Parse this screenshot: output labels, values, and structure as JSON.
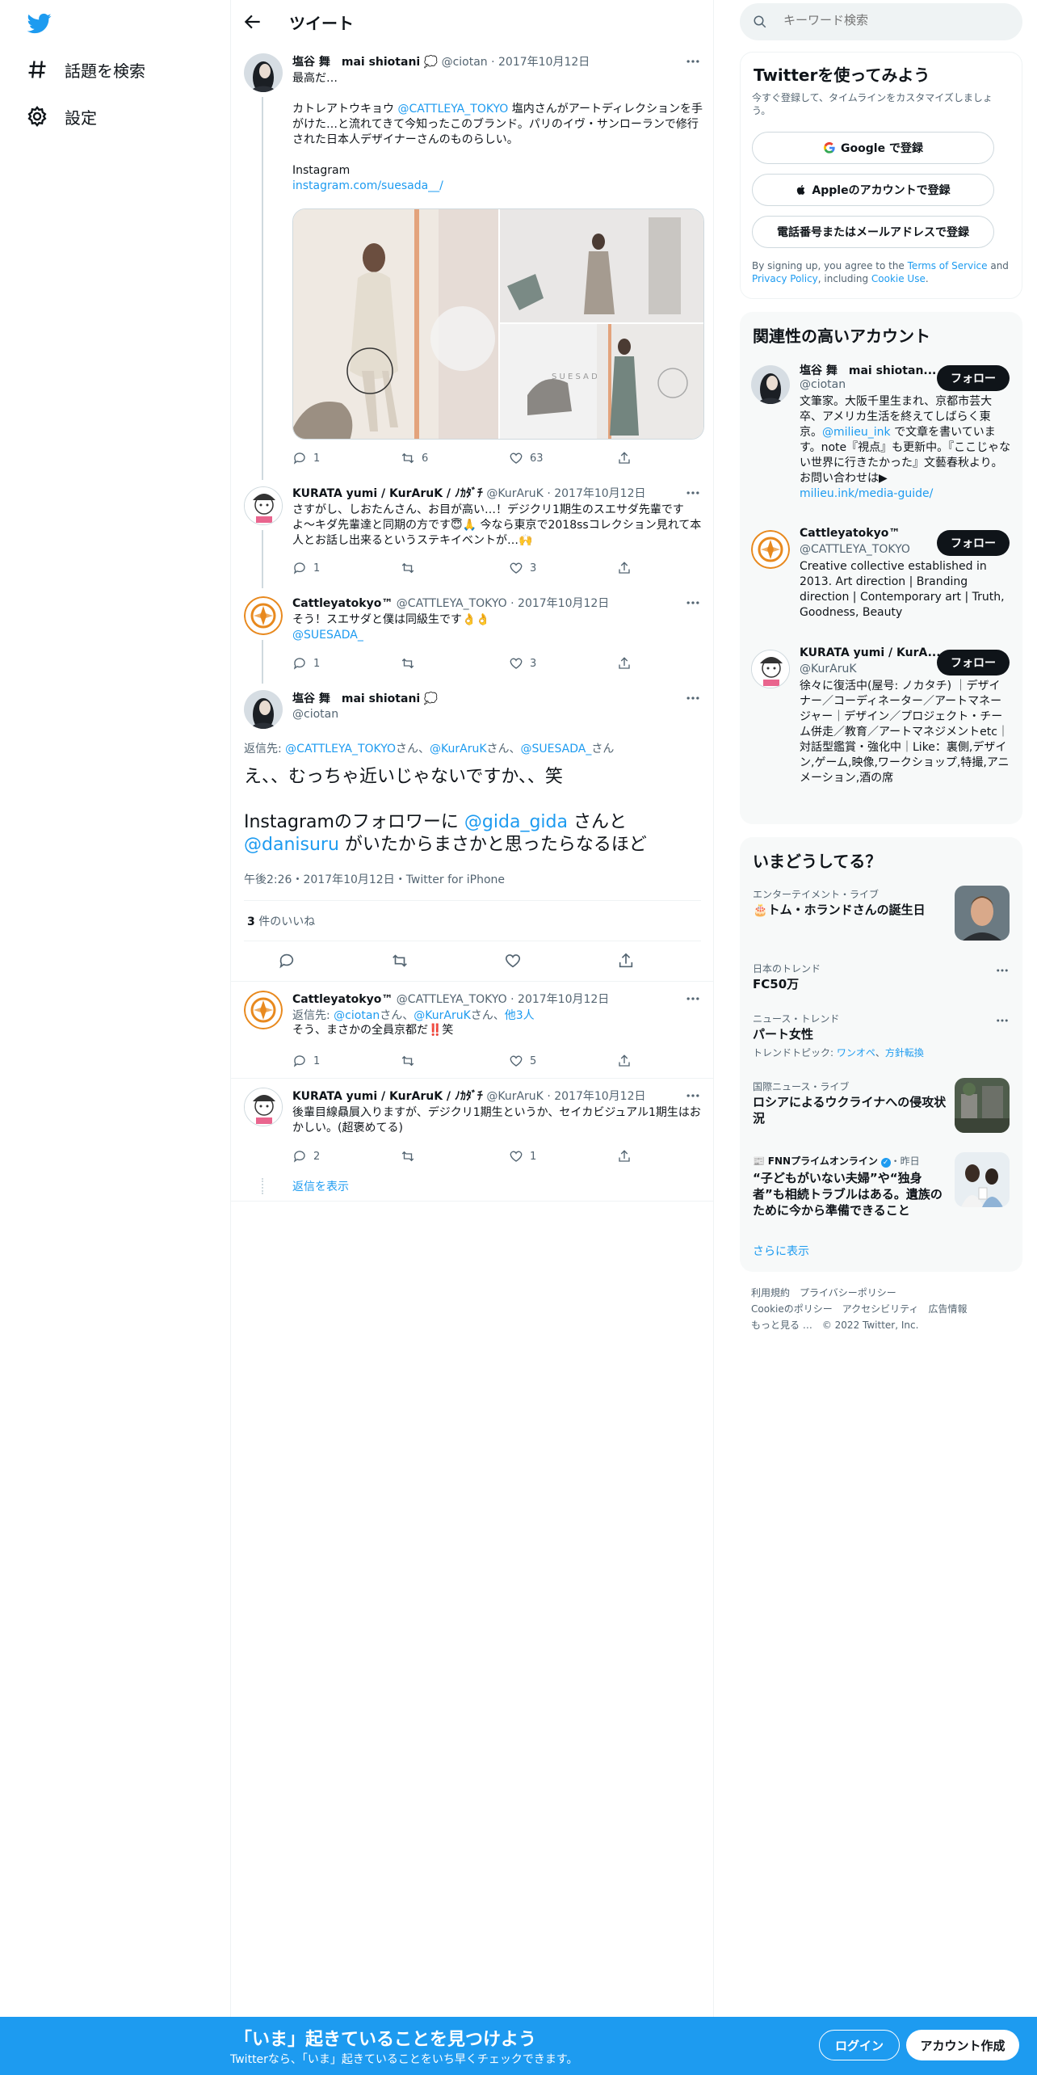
{
  "nav": {
    "explore_label": "話題を検索",
    "settings_label": "設定"
  },
  "header": {
    "title": "ツイート"
  },
  "tweets": [
    {
      "name": "塩谷 舞　mai shiotani",
      "handle": "@ciotan",
      "date": "2017年10月12日",
      "text_intro": "最高だ…",
      "text_body_pre": "カトレアトウキョウ ",
      "text_mention": "@CATTLEYA_TOKYO",
      "text_body_post": " 塩内さんがアートディレクションを手がけた…と流れてきて今知ったこのブランド。パリのイヴ・サンローランで修行された日本人デザイナーさんのものらしい。",
      "text_instagram": "Instagram",
      "text_link": "instagram.com/suesada__/",
      "replies": "1",
      "retweets": "6",
      "likes": "63"
    },
    {
      "name": "KURATA yumi / KurAruK / ﾉｶﾀﾞﾁ",
      "handle": "@KurAruK",
      "date": "2017年10月12日",
      "text": "さすがし、しおたんさん、お目が高い…！デジクリ1期生のスエサダ先輩ですよ〜キダ先輩達と同期の方です😇🙏 今なら東京で2018ssコレクション見れて本人とお話し出来るというステキイベントが…🙌",
      "replies": "1",
      "retweets": "",
      "likes": "3"
    },
    {
      "name": "Cattleyatokyo™",
      "handle": "@CATTLEYA_TOKYO",
      "date": "2017年10月12日",
      "text": "そう！スエサダと僕は同級生です👌👌",
      "mention": "@SUESADA_",
      "replies": "1",
      "retweets": "",
      "likes": "3"
    }
  ],
  "focus": {
    "name": "塩谷 舞　mai shiotani",
    "handle": "@ciotan",
    "reply_to_label": "返信先:",
    "reply_to_1": "@CATTLEYA_TOKYO",
    "reply_to_san1": "さん、",
    "reply_to_2": "@KurAruK",
    "reply_to_san2": "さん、",
    "reply_to_3": "@SUESADA_",
    "reply_to_san3": "さん",
    "line1": "え、、むっちゃ近いじゃないですか、、笑",
    "line2_pre": "Instagramのフォロワーに ",
    "line2_m1": "@gida_gida",
    "line2_mid": " さんと",
    "line3_m2": "@danisuru",
    "line3_post": " がいたからまさかと思ったらなるほど",
    "meta": "午後2:26・2017年10月12日・Twitter for iPhone",
    "likes_count": "3",
    "likes_label": " 件のいいね"
  },
  "replies": [
    {
      "name": "Cattleyatokyo™",
      "handle": "@CATTLEYA_TOKYO",
      "date": "2017年10月12日",
      "reply_label": "返信先: ",
      "reply_1": "@ciotan",
      "reply_san1": "さん、",
      "reply_2": "@KurAruK",
      "reply_san2": "さん、",
      "reply_more": "他3人",
      "text": "そう、まさかの全員京都だ‼️笑",
      "replies": "1",
      "retweets": "",
      "likes": "5"
    },
    {
      "name": "KURATA yumi / KurAruK / ﾉｶﾀﾞﾁ",
      "handle": "@KurAruK",
      "date": "2017年10月12日",
      "text": "後輩目線贔屓入りますが、デジクリ1期生というか、セイカビジュアル1期生はおかしい。(超褒めてる)",
      "replies": "2",
      "retweets": "",
      "likes": "1"
    }
  ],
  "show_replies": "返信を表示",
  "search": {
    "placeholder": "キーワード検索"
  },
  "signup_card": {
    "title": "Twitterを使ってみよう",
    "subtitle": "今すぐ登録して、タイムラインをカスタマイズしましょう。",
    "google": "Google で登録",
    "apple": "Appleのアカウントで登録",
    "phone": "電話番号またはメールアドレスで登録",
    "terms_pre": "By signing up, you agree to the ",
    "terms_link": "Terms of Service",
    "terms_and": " and ",
    "privacy_link": "Privacy Policy",
    "terms_including": ", including ",
    "cookie_link": "Cookie Use",
    "terms_end": "."
  },
  "accounts_card": {
    "title": "関連性の高いアカウント",
    "follow_label": "フォロー",
    "accounts": [
      {
        "name": "塩谷 舞　mai shiotan...",
        "handle": "@ciotan",
        "bio_pre": "文筆家。大阪千里生まれ、京都市芸大卒、アメリカ生活を終えてしばらく東京。",
        "bio_mention": "@milieu_ink",
        "bio_post": " で文章を書いています。note『視点』も更新中。『ここじゃない世界に行きたかった』文藝春秋より。お問い合わせは▶",
        "bio_link": "milieu.ink/media-guide/"
      },
      {
        "name": "Cattleyatokyo™",
        "handle": "@CATTLEYA_TOKYO",
        "bio": "Creative collective established in 2013. Art direction | Branding direction | Contemporary art | Truth, Goodness, Beauty"
      },
      {
        "name": "KURATA yumi / KurA...",
        "handle": "@KurAruK",
        "bio": "徐々に復活中(屋号: ノカタチ) ｜デザイナー／コーディネーター／アートマネージャー｜デザイン／プロジェクト・チーム併走／教育／アートマネジメントetc｜対話型鑑賞・強化中｜Like：裏側,デザイン,ゲーム,映像,ワークショップ,特撮,アニメーション,酒の席"
      }
    ]
  },
  "trends_card": {
    "title": "いまどうしてる？",
    "items": [
      {
        "meta": "エンターテイメント・ライブ",
        "title": "🎂トム・ホランドさんの誕生日"
      },
      {
        "meta": "日本のトレンド",
        "title": "FC50万"
      },
      {
        "meta": "ニュース・トレンド",
        "title": "パート女性",
        "topic_label": "トレンドトピック: ",
        "topic_1": "ワンオペ",
        "topic_sep": "、",
        "topic_2": "方針転換"
      },
      {
        "meta": "国際ニュース・ライブ",
        "title": "ロシアによるウクライナへの侵攻状況"
      },
      {
        "meta_source": "FNNプライムオンライン",
        "meta_time": "・昨日",
        "title": "“子どもがいない夫婦”や“独身者”も相続トラブルはある。遺族のために今から準備できること"
      }
    ],
    "show_more": "さらに表示"
  },
  "footer": {
    "terms": "利用規約",
    "privacy": "プライバシーポリシー",
    "cookie": "Cookieのポリシー",
    "accessibility": "アクセシビリティ",
    "ads": "広告情報",
    "more": "もっと見る …",
    "copyright": "© 2022 Twitter, Inc."
  },
  "bottombar": {
    "headline": "「いま」起きていることを見つけよう",
    "sub": "Twitterなら、「いま」起きていることをいち早くチェックできます。",
    "login": "ログイン",
    "signup": "アカウント作成"
  },
  "colors": {
    "accent": "#1d9bf0",
    "text": "#0f1419",
    "secondary": "#536471"
  }
}
